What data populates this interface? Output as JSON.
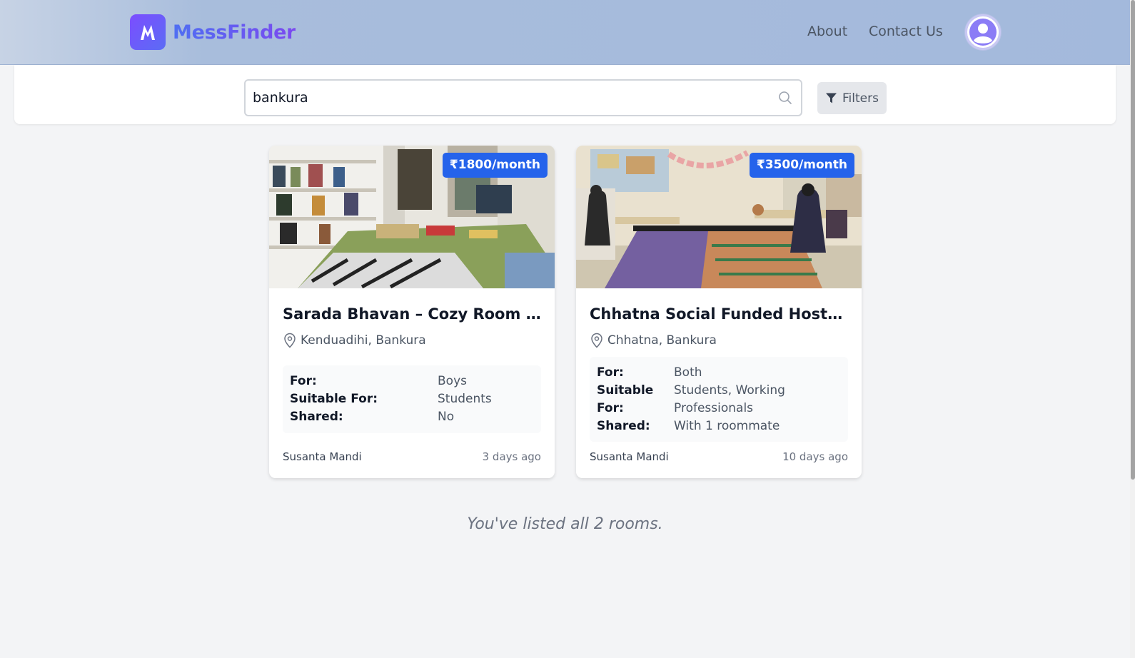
{
  "header": {
    "logo_text": "MessFinder",
    "nav": {
      "about": "About",
      "contact": "Contact Us"
    }
  },
  "search": {
    "value": "bankura",
    "filters_label": "Filters"
  },
  "listings": [
    {
      "price": "₹1800/month",
      "title": "Sarada Bhavan – Cozy Room for...",
      "location": "Kenduadihi, Bankura",
      "details": [
        {
          "key": "For:",
          "value": "Boys"
        },
        {
          "key": "Suitable For:",
          "value": "Students"
        },
        {
          "key": "Shared:",
          "value": "No"
        }
      ],
      "owner": "Susanta Mandi",
      "posted": "3 days ago"
    },
    {
      "price": "₹3500/month",
      "title": "Chhatna Social Funded Hostel f...",
      "location": "Chhatna, Bankura",
      "details": [
        {
          "key": "For:",
          "value": "Both"
        },
        {
          "key": "Suitable For:",
          "value": "Students, Working Professionals"
        },
        {
          "key": "Shared:",
          "value": "With 1 roommate"
        }
      ],
      "owner": "Susanta Mandi",
      "posted": "10 days ago"
    }
  ],
  "footer_message": "You've listed all 2 rooms.",
  "colors": {
    "accent": "#2563eb",
    "logo_gradient_start": "#7c4dff",
    "logo_gradient_end": "#5b6cf5",
    "header_bg": "#a8bddc"
  },
  "icons": {
    "logo": "m-logo-icon",
    "search": "search-icon",
    "filter": "filter-icon",
    "avatar": "user-avatar-icon",
    "location": "map-pin-icon"
  }
}
